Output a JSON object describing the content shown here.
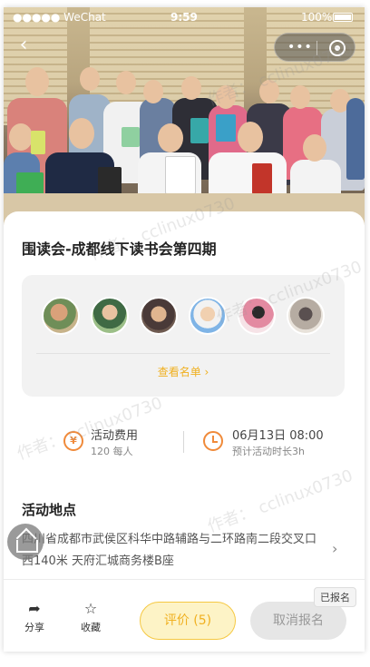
{
  "status_bar": {
    "carrier": "●●●●● WeChat",
    "time": "9:59",
    "battery": "100%"
  },
  "nav": {
    "back_icon": "chevron-left-icon",
    "more_icon": "more-dots-icon",
    "close_icon": "target-circle-icon"
  },
  "event": {
    "title": "围读会-成都线下读书会第四期",
    "members_link": "查看名单 ›",
    "fee_label": "活动费用",
    "fee_value": "120 每人",
    "date_label": "06月13日 08:00",
    "duration_label": "预计活动时长3h",
    "location_title": "活动地点",
    "location_address": "四川省成都市武侯区科华中路辅路与二环路南二段交叉口西140米 天府汇城商务楼B座"
  },
  "avatars": [
    "member-1",
    "member-2",
    "member-3",
    "member-4",
    "member-5",
    "member-6"
  ],
  "toolbar": {
    "share_label": "分享",
    "favorite_label": "收藏",
    "rate_label": "评价 (5)",
    "cancel_label": "取消报名",
    "registered_badge": "已报名"
  },
  "watermark": "作者： cclinux0730",
  "colors": {
    "accent": "#f0b020",
    "icon_orange": "#f08a3a",
    "rate_bg": "#fdf3c6",
    "cancel_bg": "#e6e6e6"
  }
}
